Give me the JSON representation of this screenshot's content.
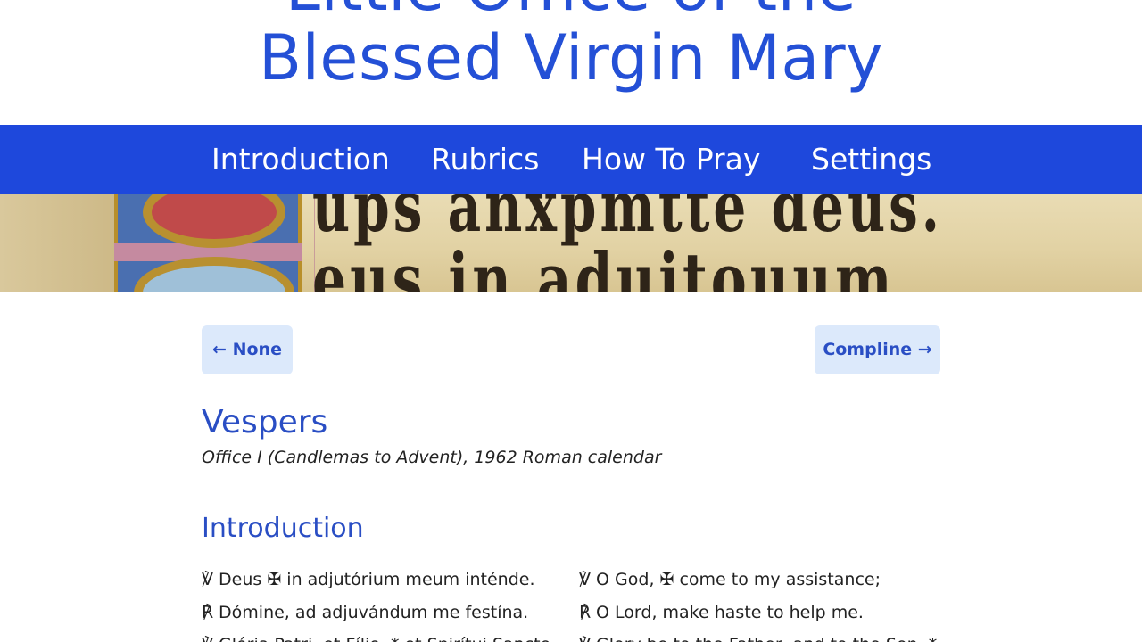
{
  "site": {
    "title_line1": "Little Office of the",
    "title_line2": "Blessed Virgin Mary"
  },
  "nav": {
    "items": [
      {
        "label": "Introduction"
      },
      {
        "label": "Rubrics"
      },
      {
        "label": "How To Pray"
      },
      {
        "label": "Settings"
      }
    ]
  },
  "banner": {
    "line1": "ups anxpmtte deus.",
    "line2": "eus in aduitouum"
  },
  "pager": {
    "prev_label": "← None",
    "next_label": "Compline →"
  },
  "page": {
    "title": "Vespers",
    "subtitle": "Office I (Candlemas to Advent), 1962 Roman calendar"
  },
  "section": {
    "heading": "Introduction"
  },
  "verses": [
    {
      "latin": "℣ Deus ✠ in adjutórium meum inténde.",
      "english": "℣ O God, ✠ come to my assistance;"
    },
    {
      "latin": "℟ Dómine, ad adjuvándum me festína.",
      "english": "℟ O Lord, make haste to help me."
    },
    {
      "latin": "℣ Glória Patri, et Fílio, * et Spirítui Sancto.",
      "english": "℣ Glory be to the Father, and to the Son, *"
    }
  ],
  "colors": {
    "brand_blue": "#1e48dc",
    "heading_blue": "#2a4ec4",
    "button_bg": "#dce9fb"
  }
}
